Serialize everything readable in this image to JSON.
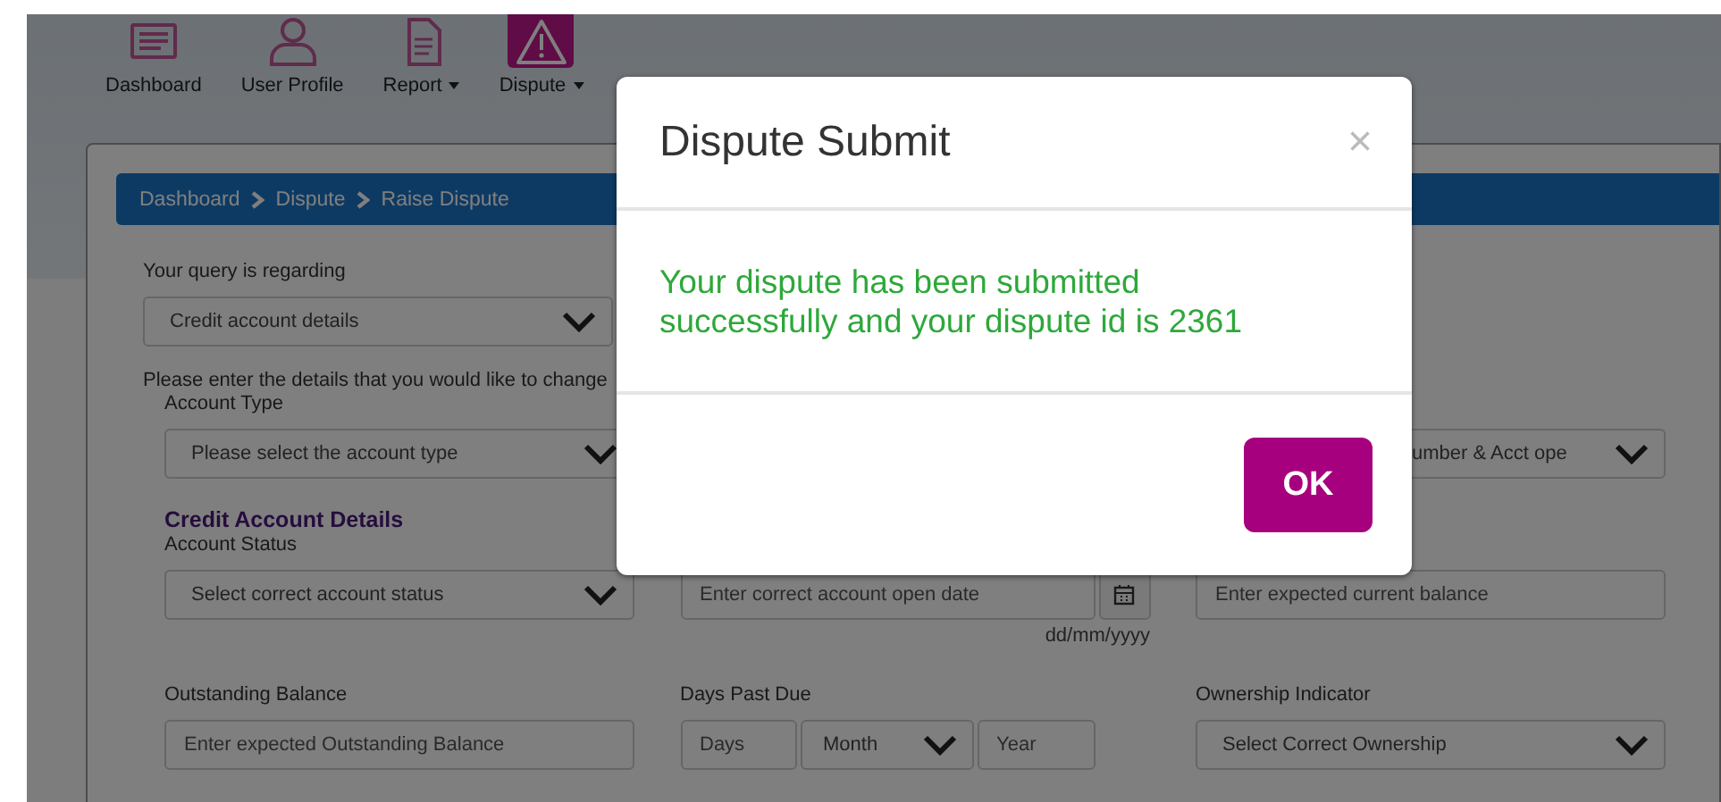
{
  "nav": {
    "items": [
      {
        "label": "Dashboard",
        "dropdown": false,
        "selected": false
      },
      {
        "label": "User Profile",
        "dropdown": false,
        "selected": false
      },
      {
        "label": "Report",
        "dropdown": true,
        "selected": false
      },
      {
        "label": "Dispute",
        "dropdown": true,
        "selected": true
      }
    ]
  },
  "breadcrumb": [
    "Dashboard",
    "Dispute",
    "Raise Dispute"
  ],
  "form": {
    "query": {
      "label": "Your query is regarding",
      "value": "Credit account details"
    },
    "instruction": "Please enter the details that you would like to change",
    "account_type": {
      "label": "Account Type",
      "placeholder": "Please select the account type"
    },
    "right_select": {
      "placeholder": "umber & Acct ope"
    },
    "section_title": "Credit Account Details",
    "fields": [
      {
        "kind": "select",
        "label": "Account Status",
        "placeholder": "Select correct account status"
      },
      {
        "kind": "date",
        "placeholder": "Enter correct account open date",
        "hint": "dd/mm/yyyy"
      },
      {
        "kind": "input",
        "placeholder": "Enter expected current balance"
      },
      {
        "kind": "input",
        "label": "Outstanding Balance",
        "placeholder": "Enter expected Outstanding Balance"
      },
      {
        "kind": "dpd",
        "label": "Days Past Due",
        "days": {
          "placeholder": "Days"
        },
        "month": "Month",
        "year": {
          "placeholder": "Year"
        }
      },
      {
        "kind": "select",
        "label": "Ownership Indicator",
        "placeholder": "Select Correct Ownership"
      }
    ]
  },
  "modal": {
    "title": "Dispute Submit",
    "close": "×",
    "message": "Your dispute has been submitted successfully and your dispute id is 2361",
    "button": "OK"
  }
}
